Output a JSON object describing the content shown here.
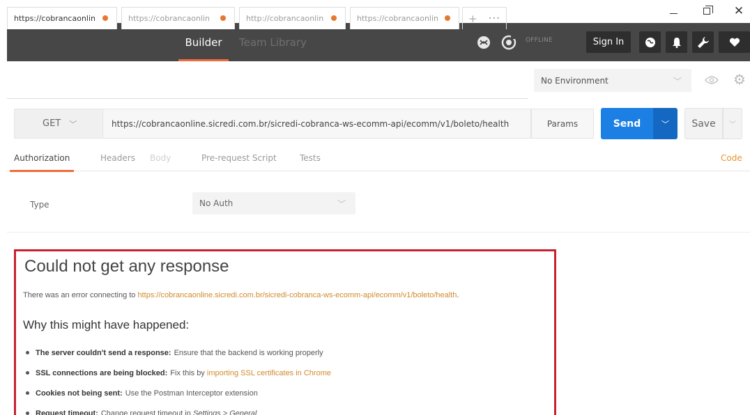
{
  "header": {
    "tabs": [
      {
        "label": "Builder"
      },
      {
        "label": "Team Library"
      }
    ],
    "offline": "OFFLINE",
    "sign_in": "Sign In"
  },
  "request_tabs": [
    {
      "label": "https://cobrancaonlin"
    },
    {
      "label": "https://cobrancaonlin"
    },
    {
      "label": "http://cobrancaonlin"
    },
    {
      "label": "https://cobrancaonlin"
    }
  ],
  "tab_add": "+",
  "tab_more": "•••",
  "environment": {
    "selected": "No Environment"
  },
  "request": {
    "method": "GET",
    "url": "https://cobrancaonline.sicredi.com.br/sicredi-cobranca-ws-ecomm-api/ecomm/v1/boleto/health",
    "params_label": "Params",
    "send_label": "Send",
    "save_label": "Save"
  },
  "subtabs": {
    "authorization": "Authorization",
    "headers": "Headers",
    "body": "Body",
    "prerequest": "Pre-request Script",
    "tests": "Tests",
    "code": "Code"
  },
  "auth": {
    "type_label": "Type",
    "type_value": "No Auth"
  },
  "error": {
    "title": "Could not get any response",
    "message_prefix": "There was an error connecting to ",
    "message_url": "https://cobrancaonline.sicredi.com.br/sicredi-cobranca-ws-ecomm-api/ecomm/v1/boleto/health",
    "message_suffix": ".",
    "why_title": "Why this might have happened:",
    "reasons": [
      {
        "title": "The server couldn't send a response:",
        "text": "Ensure that the backend is working properly"
      },
      {
        "title": "SSL connections are being blocked:",
        "text": "Fix this by ",
        "link": "importing SSL certificates in Chrome"
      },
      {
        "title": "Cookies not being sent:",
        "text": "Use the Postman Interceptor extension"
      },
      {
        "title": "Request timeout:",
        "text": "Change request timeout in ",
        "italic": "Settings > General"
      }
    ]
  },
  "colors": {
    "accent": "#f26b3a",
    "send": "#1c7fe4",
    "error_border": "#c8202e",
    "link": "#d08a2a"
  }
}
